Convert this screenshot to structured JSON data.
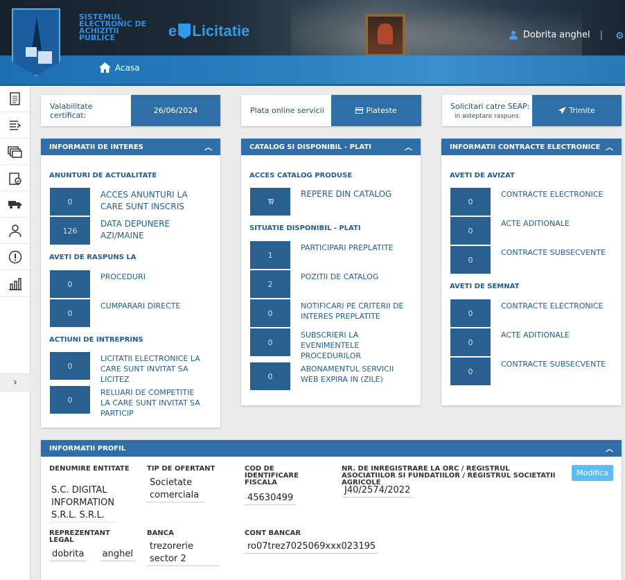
{
  "header": {
    "system_title": [
      "SISTEMUL",
      "ELECTRONIC DE",
      "ACHIZITII",
      "PUBLICE"
    ],
    "brand_prefix": "e",
    "brand_name": "Licitatie",
    "user_name": "Dobrita anghel",
    "separator": "|",
    "breadcrumb_home": "Acasa"
  },
  "top_cards": {
    "certificate_label": "Valabilitate certificat:",
    "certificate_value": "26/06/2024",
    "payment_label": "Plata online servicii",
    "payment_button": "Plateste",
    "requests_label": "Solicitari catre SEAP: 0",
    "requests_sub": "in asteptare raspuns",
    "requests_button": "Trimite"
  },
  "panel_interest": {
    "title": "INFORMATII DE INTERES",
    "sec1": "ANUNTURI DE ACTUALITATE",
    "rows1": [
      {
        "count": "0",
        "label": "ACCES ANUNTURI LA CARE SUNT INSCRIS"
      },
      {
        "count": "126",
        "label": "DATA DEPUNERE AZI/MAINE"
      }
    ],
    "sec2": "AVETI DE RASPUNS LA",
    "rows2": [
      {
        "count": "0",
        "label": "PROCEDURI"
      },
      {
        "count": "0",
        "label": "CUMPARARI DIRECTE"
      }
    ],
    "sec3": "ACTIUNI DE INTREPRINS",
    "rows3": [
      {
        "count": "0",
        "label": "LICITATII ELECTRONICE LA CARE SUNT INVITAT SA LICITEZ"
      },
      {
        "count": "0",
        "label": "RELUARI DE COMPETITIE LA CARE SUNT INVITAT SA PARTICIP"
      }
    ]
  },
  "panel_catalog": {
    "title": "CATALOG SI DISPONIBIL - PLATI",
    "sec1": "ACCES CATALOG PRODUSE",
    "catalog_label": "REPERE DIN CATALOG",
    "sec2": "SITUATIE DISPONIBIL - PLATI",
    "rows": [
      {
        "count": "1",
        "label": "PARTICIPARI PREPLATITE"
      },
      {
        "count": "2",
        "label": "POZITII DE CATALOG"
      },
      {
        "count": "0",
        "label": "NOTIFICARI PE CRITERII DE INTERES PREPLATITE"
      },
      {
        "count": "0",
        "label": "SUBSCRIERI LA EVENIMENTELE PROCEDURILOR"
      },
      {
        "count": "0",
        "label": "ABONAMENTUL SERVICII WEB EXPIRA IN (ZILE)"
      }
    ]
  },
  "panel_contracts": {
    "title": "INFORMATII CONTRACTE ELECTRONICE",
    "sec1": "AVETI DE AVIZAT",
    "rows1": [
      {
        "count": "0",
        "label": "CONTRACTE ELECTRONICE"
      },
      {
        "count": "0",
        "label": "ACTE ADITIONALE"
      },
      {
        "count": "0",
        "label": "CONTRACTE SUBSECVENTE"
      }
    ],
    "sec2": "AVETI DE SEMNAT",
    "rows2": [
      {
        "count": "0",
        "label": "CONTRACTE ELECTRONICE"
      },
      {
        "count": "0",
        "label": "ACTE ADITIONALE"
      },
      {
        "count": "0",
        "label": "CONTRACTE SUBSECVENTE"
      }
    ]
  },
  "profile": {
    "title": "INFORMATII PROFIL",
    "modify_button": "Modifica",
    "entity_label": "DENUMIRE ENTITATE",
    "entity_value": "S.C. DIGITAL INFORMATION S.R.L. S.R.L.",
    "type_label": "TIP DE OFERTANT",
    "type_value": "Societate comerciala",
    "cif_label": "COD DE IDENTIFICARE FISCALA",
    "cif_value": "45630499",
    "orc_label": "NR. DE INREGISTRARE LA ORC / REGISTRUL ASOCIATIILOR SI FUNDATIILOR / REGISTRUL SOCIETATII AGRICOLE",
    "orc_value": "J40/2574/2022",
    "rep_label": "REPREZENTANT LEGAL",
    "rep_first": "dobrita",
    "rep_last": "anghel",
    "bank_label": "BANCA",
    "bank_value": "trezorerie sector 2",
    "account_label": "CONT BANCAR",
    "account_value": "ro07trez7025069xxx023195"
  }
}
